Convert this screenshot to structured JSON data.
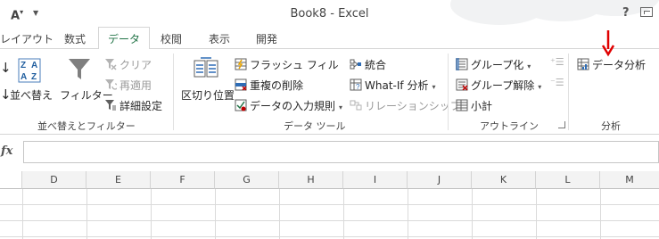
{
  "window": {
    "title": "Book8 - Excel",
    "help": "?",
    "qa_font": "A"
  },
  "tabs": [
    {
      "label": "レイアウト",
      "active": false
    },
    {
      "label": "数式",
      "active": false
    },
    {
      "label": "データ",
      "active": true
    },
    {
      "label": "校閲",
      "active": false
    },
    {
      "label": "表示",
      "active": false
    },
    {
      "label": "開発",
      "active": false
    }
  ],
  "sort_filter": {
    "sort": "並べ替え",
    "filter": "フィルター",
    "clear": "クリア",
    "reapply": "再適用",
    "advanced": "詳細設定",
    "group_label": "並べ替えとフィルター"
  },
  "data_tools": {
    "text_to_columns": "区切り位置",
    "flash_fill": "フラッシュ フィル",
    "remove_duplicates": "重複の削除",
    "data_validation": "データの入力規則",
    "consolidate": "統合",
    "whatif": "What-If 分析",
    "relationships": "リレーションシップ",
    "group_label": "データ ツール"
  },
  "outline": {
    "group": "グループ化",
    "ungroup": "グループ解除",
    "subtotal": "小計",
    "group_label": "アウトライン"
  },
  "analysis": {
    "data_analysis": "データ分析",
    "group_label": "分析"
  },
  "formula_bar": {
    "fx": "fx",
    "value": ""
  },
  "columns": [
    "D",
    "E",
    "F",
    "G",
    "H",
    "I",
    "J",
    "K",
    "L",
    "M"
  ],
  "colors": {
    "accent": "#217346",
    "annotation_arrow": "#e00000"
  }
}
